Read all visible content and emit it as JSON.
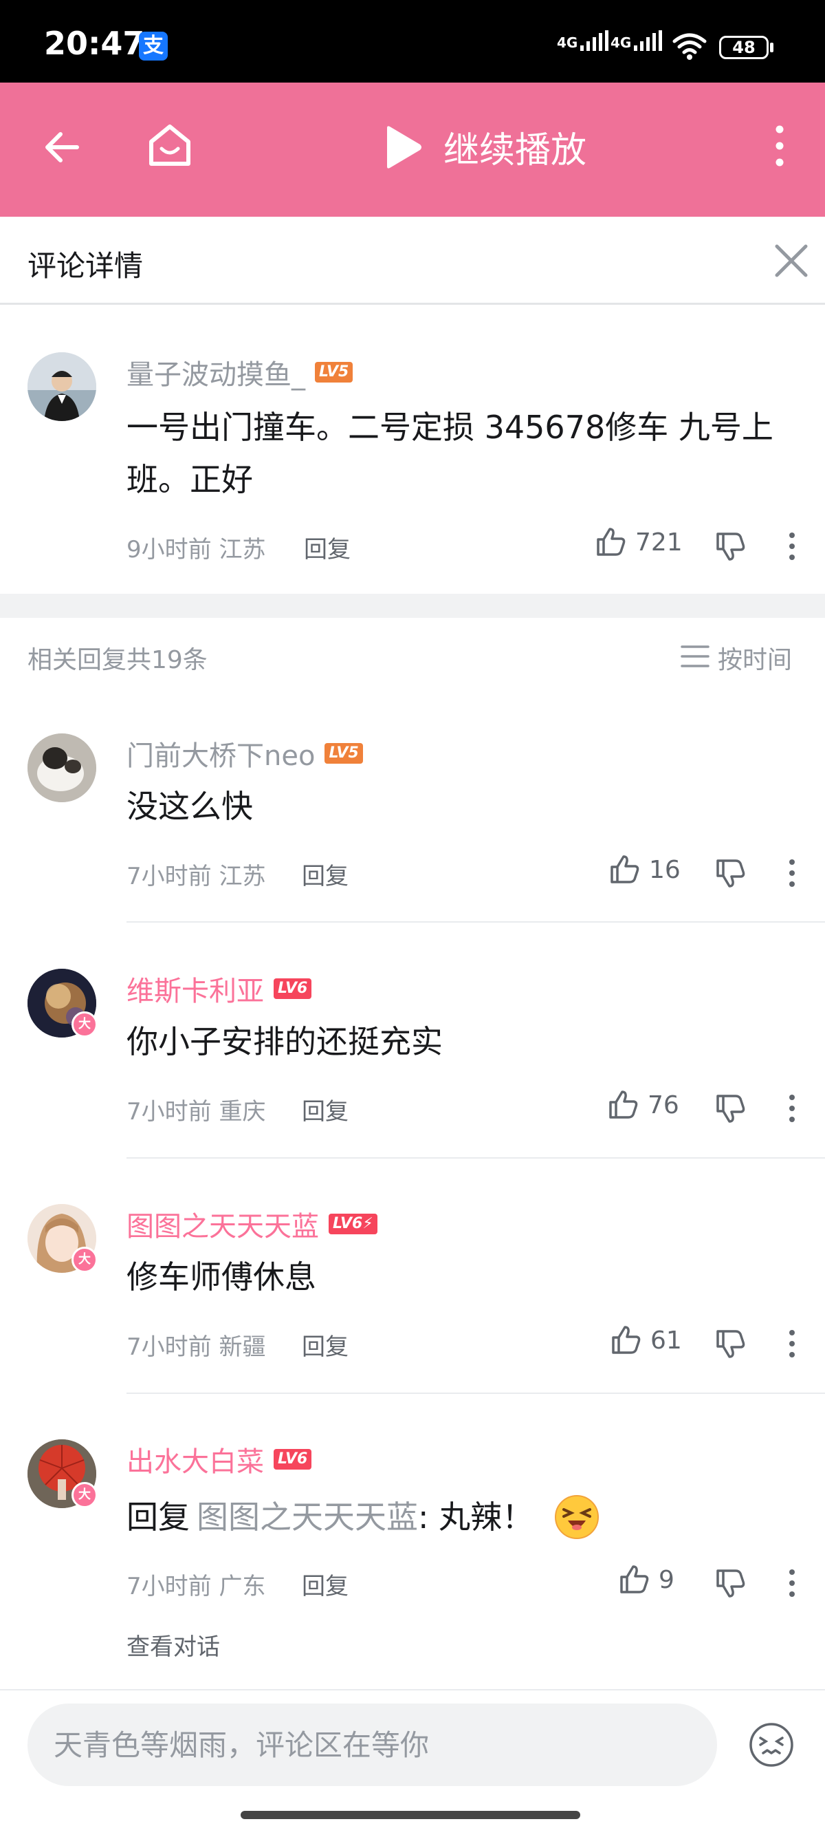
{
  "status_bar": {
    "time": "20:47",
    "alipay_glyph": "支",
    "net1": "4G",
    "net2": "4G",
    "battery": "48"
  },
  "header": {
    "resume_label": "继续播放"
  },
  "detail": {
    "title": "评论详情"
  },
  "root_comment": {
    "username": "量子波动摸鱼_",
    "level": "LV5",
    "content": "一号出门撞车。二号定损  345678修车 九号上班。正好",
    "time_location": "9小时前 江苏",
    "reply_label": "回复",
    "likes": "721"
  },
  "replies_header": {
    "total": "相关回复共19条",
    "sort": "按时间"
  },
  "replies": [
    {
      "username": "门前大桥下neo",
      "level": "LV5",
      "content": "没这么快",
      "time_location": "7小时前 江苏",
      "reply_label": "回复",
      "likes": "16"
    },
    {
      "username": "维斯卡利亚",
      "level": "LV6",
      "vip_badge": "大",
      "content": "你小子安排的还挺充实",
      "time_location": "7小时前 重庆",
      "reply_label": "回复",
      "likes": "76"
    },
    {
      "username": "图图之天天天蓝",
      "level": "LV6⚡",
      "vip_badge": "大",
      "content": "修车师傅休息",
      "time_location": "7小时前 新疆",
      "reply_label": "回复",
      "likes": "61"
    },
    {
      "username": "出水大白菜",
      "level": "LV6",
      "vip_badge": "大",
      "content_prefix": "回复",
      "content_mention": "图图之天天天蓝",
      "content_text": ": 丸辣！",
      "time_location": "7小时前 广东",
      "reply_label": "回复",
      "likes": "9"
    }
  ],
  "view_conversation": "查看对话",
  "input": {
    "placeholder": "天青色等烟雨，评论区在等你"
  },
  "colors": {
    "header": "#ef7198",
    "vip_name": "#fb7299",
    "lv5": "#f0813a",
    "lv6": "#f6455c"
  },
  "icons": [
    "back-arrow-icon",
    "home-icon",
    "play-icon",
    "more-vert-icon",
    "close-icon",
    "thumb-up-icon",
    "thumb-down-icon",
    "sort-list-icon",
    "emoji-icon"
  ]
}
